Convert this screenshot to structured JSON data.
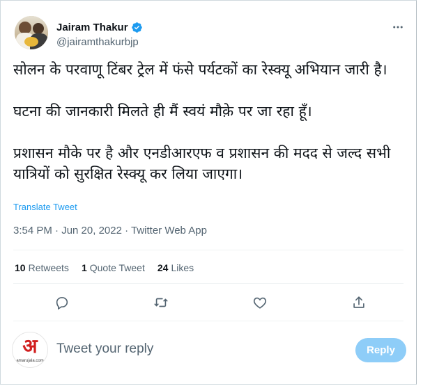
{
  "author": {
    "name": "Jairam Thakur",
    "handle": "@jairamthakurbjp",
    "verified_icon": "verified-badge-icon",
    "avatar_icon": "profile-photo"
  },
  "tweet": {
    "paragraphs": [
      "सोलन के परवाणू टिंबर ट्रेल में फंसे पर्यटकों का रेस्क्यू अभियान जारी है।",
      "घटना की जानकारी मिलते ही मैं स्वयं मौक़े पर जा रहा हूँ।",
      "प्रशासन मौके पर है और एनडीआरएफ व प्रशासन की मदद से जल्द सभी यात्रियों को सुरक्षित रेस्क्यू कर लिया जाएगा।"
    ],
    "translate_label": "Translate Tweet",
    "meta": "3:54 PM · Jun 20, 2022 · Twitter Web App"
  },
  "stats": {
    "retweets_count": "10",
    "retweets_label": "Retweets",
    "quotes_count": "1",
    "quotes_label": "Quote Tweet",
    "likes_count": "24",
    "likes_label": "Likes"
  },
  "actions": [
    "reply-icon",
    "retweet-icon",
    "like-icon",
    "share-icon"
  ],
  "reply": {
    "placeholder": "Tweet your reply",
    "button_label": "Reply",
    "avatar_logo": "अ",
    "avatar_caption": "amarujala.com"
  },
  "colors": {
    "accent": "#1d9bf0",
    "reply_button_disabled": "#8ecdf8",
    "muted_text": "#536471"
  }
}
